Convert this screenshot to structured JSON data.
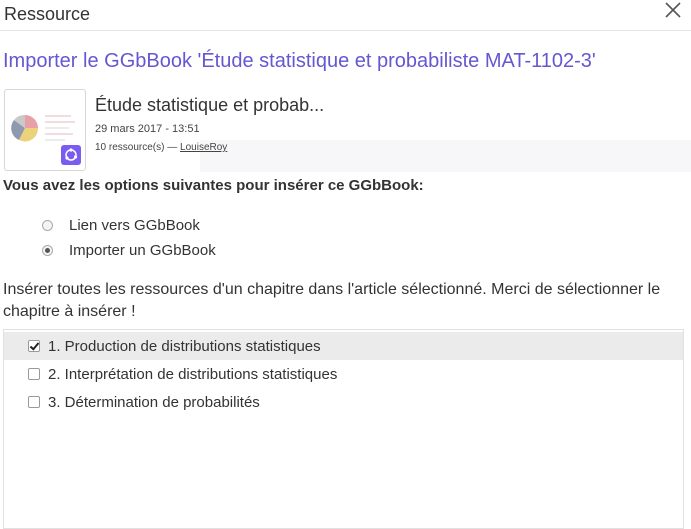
{
  "dialog": {
    "title": "Ressource",
    "close_icon": "close-icon"
  },
  "import": {
    "heading": "Importer le GGbBook 'Étude statistique et probabiliste MAT-1102-3'"
  },
  "book": {
    "title": "Étude statistique et probab...",
    "date": "29 mars 2017 - 13:51",
    "resources": "10 ressource(s)",
    "separator": " — ",
    "author": "LouiseRoy",
    "badge_icon": "geogebra-book-icon"
  },
  "options": {
    "label": "Vous avez les options suivantes pour insérer ce GGbBook:",
    "items": [
      {
        "label": "Lien vers GGbBook",
        "checked": false
      },
      {
        "label": "Importer un GGbBook",
        "checked": true
      }
    ]
  },
  "chapters": {
    "instructions": "Insérer toutes les ressources d'un chapitre dans l'article sélectionné. Merci de sélectionner le chapitre à insérer !",
    "items": [
      {
        "label": "1. Production de distributions statistiques",
        "checked": true
      },
      {
        "label": "2. Interprétation de distributions statistiques",
        "checked": false
      },
      {
        "label": "3. Détermination de probabilités",
        "checked": false
      }
    ]
  },
  "colors": {
    "accent": "#6557d2",
    "badge": "#7a5cf0",
    "selected_row": "#ebebeb"
  }
}
